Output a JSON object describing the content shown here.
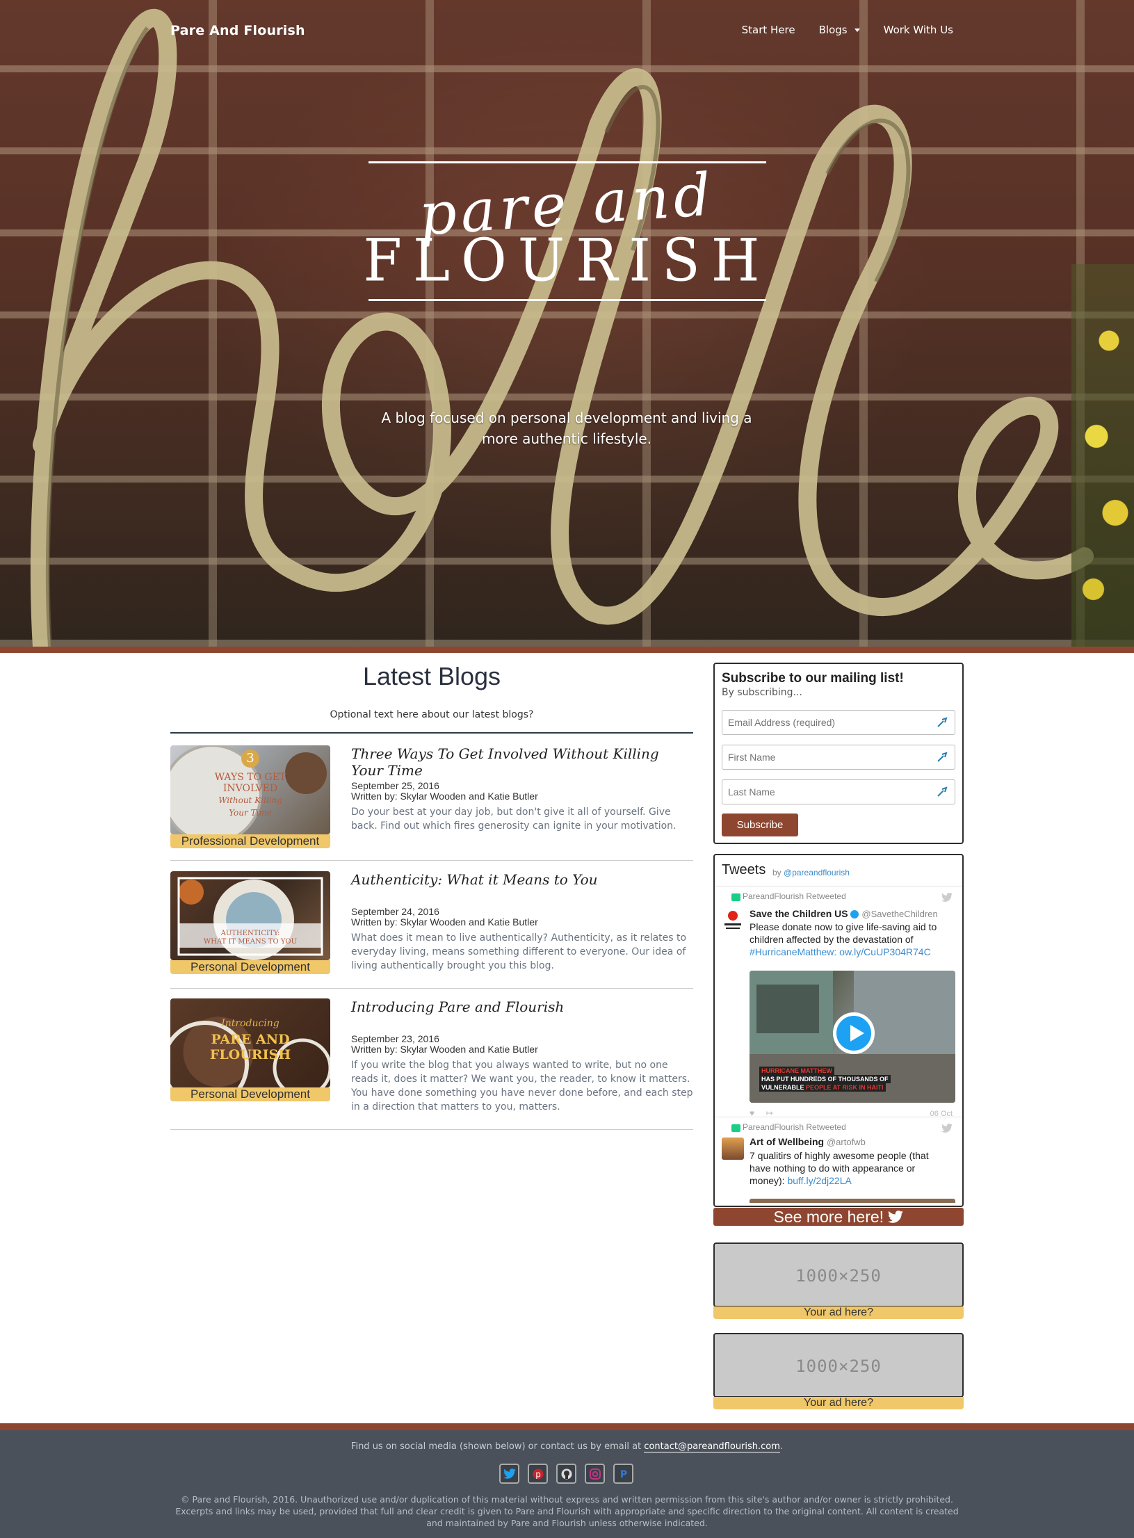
{
  "nav": {
    "brand": "Pare And Flourish",
    "items": [
      {
        "label": "Start Here"
      },
      {
        "label": "Blogs",
        "dropdown": true
      },
      {
        "label": "Work With Us"
      }
    ]
  },
  "hero": {
    "logo_script": "pare and",
    "logo_caps": "FLOURISH",
    "tagline": "A blog focused on personal development and living a more authentic lifestyle."
  },
  "latest": {
    "title": "Latest Blogs",
    "subtitle": "Optional text here about our latest blogs?"
  },
  "posts": [
    {
      "title": "Three Ways To Get Involved Without Killing Your Time",
      "date": "September 25, 2016",
      "author": "Written by: Skylar Wooden and Katie Butler",
      "excerpt": "Do your best at your day job, but don't give it all of yourself. Give back. Find out which fires generosity can ignite in your motivation.",
      "category": "Professional Development",
      "thumb_lines": [
        "3",
        "WAYS TO GET",
        "INVOLVED",
        "Without Killing",
        "Your Time"
      ]
    },
    {
      "title": "Authenticity: What it Means to You",
      "date": "September 24, 2016",
      "author": "Written by: Skylar Wooden and Katie Butler",
      "excerpt": "What does it mean to live authentically? Authenticity, as it relates to everyday living, means something different to everyone. Our idea of living authentically brought you this blog.",
      "category": "Personal Development",
      "thumb_lines": [
        "AUTHENTICITY:",
        "WHAT IT MEANS TO YOU"
      ]
    },
    {
      "title": "Introducing Pare and Flourish",
      "date": "September 23, 2016",
      "author": "Written by: Skylar Wooden and Katie Butler",
      "excerpt": "If you write the blog that you always wanted to write, but no one reads it, does it matter? We want you, the reader, to know it matters. You have done something you have never done before, and each step in a direction that matters to you, matters.",
      "category": "Personal Development",
      "thumb_lines": [
        "Introducing",
        "PARE AND",
        "FLOURISH"
      ]
    }
  ],
  "subscribe": {
    "title": "Subscribe to our mailing list!",
    "description": "By subscribing...",
    "email_placeholder": "Email Address (required)",
    "first_placeholder": "First Name",
    "last_placeholder": "Last Name",
    "button": "Subscribe"
  },
  "tweets": {
    "title": "Tweets",
    "by": "by",
    "handle": "@pareandflourish",
    "items": [
      {
        "retweet_label": "PareandFlourish Retweeted",
        "name": "Save the Children US",
        "handle": "@SavetheChildren",
        "text": "Please donate now to give life-saving aid to children affected by the devastation of",
        "hashtag": "#HurricaneMatthew:",
        "link": "ow.ly/CuUP304R74C",
        "media_caption_1": "HURRICANE MATTHEW",
        "media_caption_2": "HAS PUT HUNDREDS OF THOUSANDS OF",
        "media_caption_3a": "VULNERABLE",
        "media_caption_3b": "PEOPLE AT RISK IN HAITI",
        "date": "06 Oct"
      },
      {
        "retweet_label": "PareandFlourish Retweeted",
        "name": "Art of Wellbeing",
        "handle": "@artofwb",
        "text": "7 qualitirs of highly awesome people (that have nothing to do with appearance or money):",
        "link": "buff.ly/2dj22LA"
      }
    ],
    "see_more": "See more here!"
  },
  "ads": [
    {
      "placeholder": "1000×250",
      "label": "Your ad here?"
    },
    {
      "placeholder": "1000×250",
      "label": "Your ad here?"
    }
  ],
  "footer": {
    "contact_prefix": "Find us on social media (shown below) or contact us by email at",
    "email": "contact@pareandflourish.com",
    "contact_suffix": ".",
    "social": [
      "twitter-icon",
      "pinterest-icon",
      "github-icon",
      "instagram-icon",
      "paypal-icon"
    ],
    "legal": "© Pare and Flourish, 2016. Unauthorized use and/or duplication of this material without express and written permission from this site's author and/or owner is strictly prohibited. Excerpts and links may be used, provided that full and clear credit is given to Pare and Flourish with appropriate and specific direction to the original content. All content is created and maintained by Pare and Flourish unless otherwise indicated."
  },
  "colors": {
    "accent_brown": "#8e4630",
    "accent_gold": "#f0c769",
    "footer_bg": "#4a515b",
    "link_blue": "#3a8cd0"
  }
}
